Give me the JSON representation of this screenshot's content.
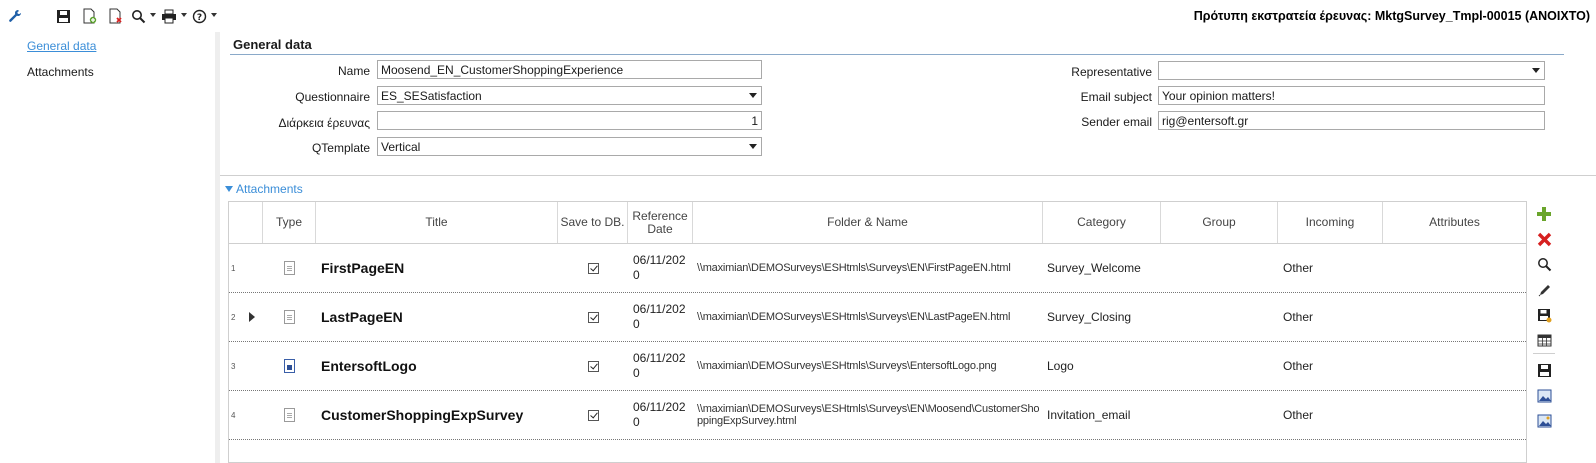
{
  "window": {
    "title": "Πρότυπη εκστρατεία έρευνας: MktgSurvey_Tmpl-00015 (ΑΝΟΙΧΤΟ)"
  },
  "toolbar": {
    "icons": [
      "wrench-icon",
      "save-icon",
      "new-document-icon",
      "delete-document-icon",
      "search-icon",
      "print-icon",
      "help-icon"
    ]
  },
  "nav": {
    "items": [
      {
        "label": "General data",
        "active": true
      },
      {
        "label": "Attachments",
        "active": false
      }
    ]
  },
  "general": {
    "section_title": "General data",
    "name_label": "Name",
    "name_value": "Moosend_EN_CustomerShoppingExperience",
    "questionnaire_label": "Questionnaire",
    "questionnaire_value": "ES_SESatisfaction",
    "duration_label": "Διάρκεια έρευνας",
    "duration_value": "1",
    "qtemplate_label": "QTemplate",
    "qtemplate_value": "Vertical",
    "representative_label": "Representative",
    "representative_value": "",
    "email_subject_label": "Email subject",
    "email_subject_value": "Your opinion matters!",
    "sender_email_label": "Sender email",
    "sender_email_value": "rig@entersoft.gr"
  },
  "attachments": {
    "header": "Attachments",
    "columns": {
      "type": "Type",
      "title": "Title",
      "save_to_db": "Save to DB.",
      "reference_date": "Reference Date",
      "folder_name": "Folder & Name",
      "category": "Category",
      "group": "Group",
      "incoming": "Incoming",
      "attributes": "Attributes"
    },
    "rows": [
      {
        "num": "1",
        "type_icon": "document-icon",
        "title": "FirstPageEN",
        "save_to_db": true,
        "date": "06/11/2020",
        "path": "\\\\maximian\\DEMOSurveys\\ESHtmls\\Surveys\\EN\\FirstPageEN.html",
        "category": "Survey_Welcome",
        "group": "",
        "incoming": "Other",
        "attributes": "",
        "current": false
      },
      {
        "num": "2",
        "type_icon": "document-icon",
        "title": "LastPageEN",
        "save_to_db": true,
        "date": "06/11/2020",
        "path": "\\\\maximian\\DEMOSurveys\\ESHtmls\\Surveys\\EN\\LastPageEN.html",
        "category": "Survey_Closing",
        "group": "",
        "incoming": "Other",
        "attributes": "",
        "current": true
      },
      {
        "num": "3",
        "type_icon": "image-icon",
        "title": "EntersoftLogo",
        "save_to_db": true,
        "date": "06/11/2020",
        "path": "\\\\maximian\\DEMOSurveys\\ESHtmls\\Surveys\\EntersoftLogo.png",
        "category": "Logo",
        "group": "",
        "incoming": "Other",
        "attributes": "",
        "current": false
      },
      {
        "num": "4",
        "type_icon": "document-icon",
        "title": "CustomerShoppingExpSurvey",
        "save_to_db": true,
        "date": "06/11/2020",
        "path": "\\\\maximian\\DEMOSurveys\\ESHtmls\\Surveys\\EN\\Moosend\\CustomerShoppingExpSurvey.html",
        "category": "Invitation_email",
        "group": "",
        "incoming": "Other",
        "attributes": "",
        "current": false
      }
    ]
  },
  "side_toolbar": {
    "icons": [
      "add-icon",
      "remove-icon",
      "zoom-icon",
      "edit-icon",
      "save-to-db-icon",
      "table-icon",
      "save-icon",
      "image-icon",
      "image-preview-icon"
    ]
  },
  "colors": {
    "link": "#3b8ed8",
    "add": "#6aa52b",
    "remove": "#d62020"
  }
}
